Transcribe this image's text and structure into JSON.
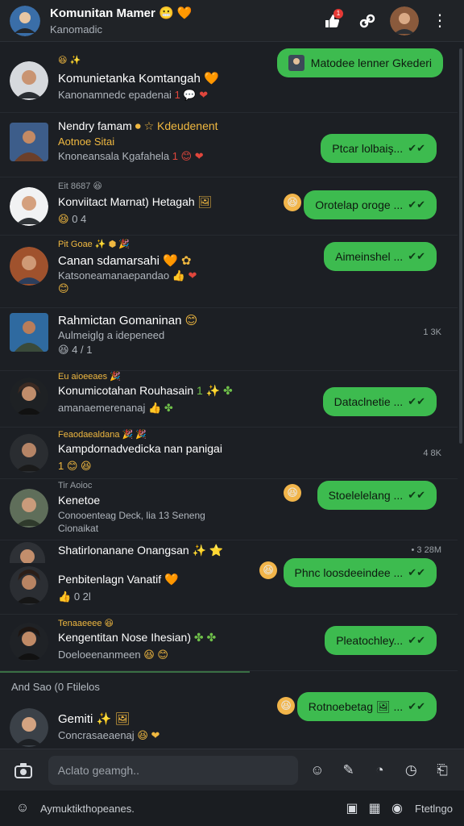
{
  "header": {
    "title": "Komunitan Mamer",
    "title_emoji": "😬 🧡",
    "subtitle": "Kanomadic",
    "notifications_badge": "1"
  },
  "top_bubble": {
    "text": "Matodee lenner Gkederi"
  },
  "chats": [
    {
      "meta": "😆 ✨",
      "name": "Komunietanka Komtangah",
      "name_emoji": "🧡",
      "preview": "Kanonamnedc epadenai",
      "preview_emoji": "1 💬 ❤",
      "bubble": "",
      "time": ""
    },
    {
      "meta": "",
      "name": "Nendry famam",
      "name_emoji": "⏺ ☆ Kdeudenent",
      "subline": "Aotnoe Sitai",
      "preview": "Knoneansala Kgafahela",
      "preview_emoji": "1 😊 ❤",
      "bubble": "Ptcar lolbaiş...",
      "time": ""
    },
    {
      "meta": "Eit 8687 😆",
      "name": "Konviitact Marnat) Hetagah",
      "name_emoji": "🖼",
      "preview": "0 4",
      "preview_emoji": "😆",
      "bubble": "Orotelap oroge ...",
      "time": ""
    },
    {
      "meta": "Pit Goae ✨ ⬢ 🎉",
      "name": "Canan sdamarsahi",
      "name_emoji": "🧡 ✿",
      "preview": "Katsoneamanaepandao",
      "preview_emoji": "👍 ❤",
      "extra": "😊",
      "bubble": "Aimeinshel ...",
      "time": ""
    },
    {
      "meta": "",
      "name": "Rahmictan Gomaninan",
      "name_emoji": "😊",
      "preview": "Aulmeiglg a idepeneed",
      "preview_emoji": "",
      "extra": "😆 4 / 1",
      "bubble": "",
      "time": "1 3K"
    },
    {
      "meta": "Eu aioeeaes 🎉",
      "name": "Konumicotahan Rouhasain",
      "name_emoji": "1 ✨ ✤",
      "preview": "amanaemerenanaj",
      "preview_emoji": "👍 ✤",
      "bubble": "Dataclnetie ...",
      "time": ""
    },
    {
      "meta": "Feaodaealdana 🎉 🎉",
      "name": "Kampdornadvedicka nan panigai",
      "name_emoji": "",
      "preview": "1 😊 😆",
      "preview_emoji": "",
      "bubble": "",
      "time": "4 8K"
    },
    {
      "meta": "Tir Aoioc",
      "name": "Kenetoe",
      "name_emoji": "",
      "preview": "Conooenteag Deck, lia 13 Seneng",
      "preview_emoji": "",
      "extra": "Cionaikat",
      "bubble": "Stoelelelang ...",
      "time": ""
    },
    {
      "meta": "",
      "name": "Shatirlonanane Onangsan",
      "name_emoji": "✨ ⭐",
      "preview": "",
      "preview_emoji": "",
      "bubble": "",
      "time": "• 3 28M"
    },
    {
      "meta": "",
      "name": "Penbitenlagn Vanatif",
      "name_emoji": "🧡",
      "preview": "0 2l",
      "preview_emoji": "👍",
      "bubble": "Phnc loosdeeindee ...",
      "time": ""
    },
    {
      "meta": "Tenaaeeee 😆",
      "name": "Kengentitan Nose Ihesian)",
      "name_emoji": "✤ ✤",
      "preview": "Doeloeenanmeen",
      "preview_emoji": "😆 😊",
      "bubble": "Pleatochley...",
      "time": ""
    }
  ],
  "section": {
    "label": "And Sao (0 Ftilelos"
  },
  "last_chat": {
    "name": "Gemiti",
    "name_emoji": "✨ 🖼",
    "preview": "Concrasaeaenaj",
    "preview_emoji": "😆 ❤",
    "bubble": "Rotnoebetag 🖼 ..."
  },
  "composer": {
    "placeholder": "Aclato geamgh.."
  },
  "bottom": {
    "label": "Aymuktikthopeanes.",
    "right_label": "Ftetlngo"
  }
}
